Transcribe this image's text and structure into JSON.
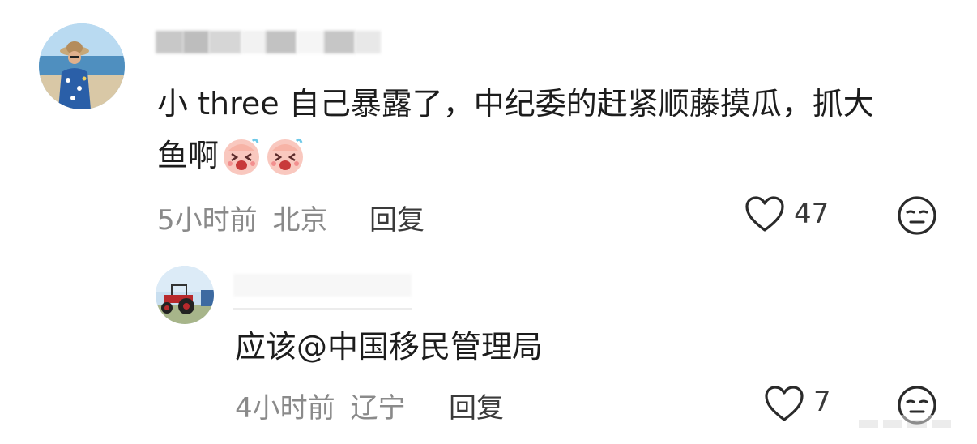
{
  "comments": [
    {
      "text_line1": "小 three 自己暴露了，中纪委的赶紧顺藤摸瓜，抓大",
      "text_line2": "鱼啊",
      "time": "5小时前",
      "location": "北京",
      "reply_label": "回复",
      "like_count": "47",
      "emoji_icon": "laughing-face-emoji"
    },
    {
      "text": "应该@中国移民管理局",
      "time": "4小时前",
      "location": "辽宁",
      "reply_label": "回复",
      "like_count": "7"
    }
  ],
  "colors": {
    "meta_gray": "#8a8a8a",
    "text_dark": "#1c1c1c",
    "blur_gray": "#c9c9c9"
  }
}
